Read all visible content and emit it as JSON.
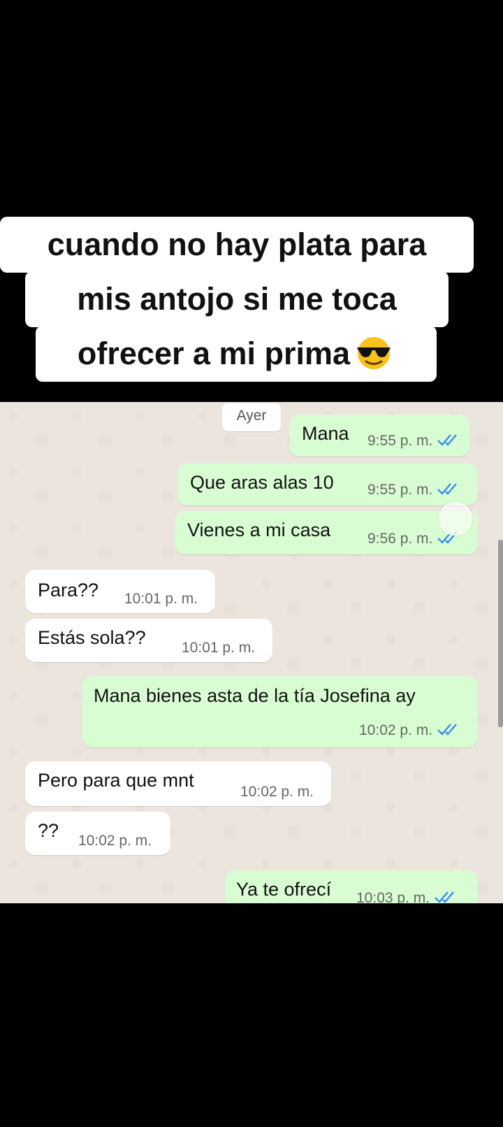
{
  "caption": {
    "line1": "cuando no hay plata para",
    "line2": "mis antojo si me toca",
    "line3": "ofrecer a mi prima",
    "emoji": "sunglasses-face-emoji"
  },
  "chat": {
    "day_label": "Ayer",
    "messages": [
      {
        "dir": "out",
        "text": "Mana",
        "time": "9:55 p. m.",
        "status": "read"
      },
      {
        "dir": "out",
        "text": "Que aras alas 10",
        "time": "9:55 p. m.",
        "status": "read"
      },
      {
        "dir": "out",
        "text": "Vienes a mi casa",
        "time": "9:56 p. m.",
        "status": "read"
      },
      {
        "dir": "in",
        "text": "Para??",
        "time": "10:01 p. m."
      },
      {
        "dir": "in",
        "text": "Estás sola??",
        "time": "10:01 p. m."
      },
      {
        "dir": "out",
        "text": "Mana bienes asta de la tía Josefina ay",
        "time": "10:02 p. m.",
        "status": "read"
      },
      {
        "dir": "in",
        "text": "Pero para que mnt",
        "time": "10:02 p. m."
      },
      {
        "dir": "in",
        "text": "??",
        "time": "10:02 p. m."
      },
      {
        "dir": "out",
        "text": "Ya te ofrecí",
        "time": "10:03 p. m.",
        "status": "read"
      }
    ]
  },
  "colors": {
    "outgoing_bubble": "#d9fdd3",
    "incoming_bubble": "#ffffff",
    "chat_background": "#ece5dd",
    "read_ticks": "#3b8cf0"
  }
}
